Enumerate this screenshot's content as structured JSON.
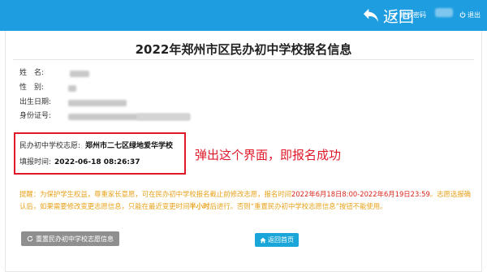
{
  "header": {
    "back_label": "返回",
    "change_password_label": "修改密码",
    "logout_label": "退出",
    "back_icon": "back-arrow-icon",
    "password_icon": "edit-icon",
    "logout_icon": "power-icon",
    "bar_color": "#1e9ee0"
  },
  "page": {
    "title": "2022年郑州市区民办初中学校报名信息"
  },
  "student": {
    "name_label": "姓　名:",
    "gender_label": "性　别:",
    "birth_label": "出生日期:",
    "id_label": "身份证号:"
  },
  "application": {
    "choice_label": "民办初中学校志愿:",
    "choice_value": "郑州市二七区绿地爱华学校",
    "time_label": "填报时间:",
    "time_value": "2022-06-18 08:26:37",
    "highlight_color": "#e0192a"
  },
  "annotation": "弹出这个界面，即报名成功",
  "notice": {
    "part1": "提醒：为保护学生权益，尊重家长意愿，可在民办初中学校报名截止前修改志愿，报名时间",
    "period": "2022年6月18日8:00-2022年6月19日23:59",
    "part2": "。志愿选报确认后，如果需要修改变更志愿信息，只能在最近变更时间",
    "wait": "半小时",
    "part3": "后进行。否则",
    "button_ref": "“重置民办初中学校志愿信息”",
    "part4": "按钮不能使用。",
    "color": "#e8a21b"
  },
  "actions": {
    "reset_label": "重置民办初中学校志愿信息",
    "home_label": "返回首页",
    "reset_icon": "refresh-icon",
    "home_icon": "home-icon"
  }
}
